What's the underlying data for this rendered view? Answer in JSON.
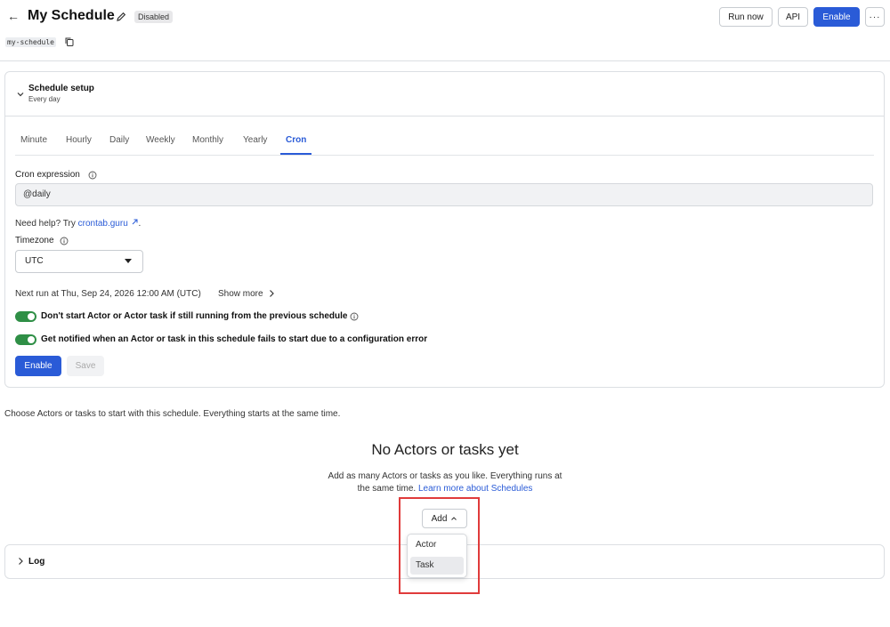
{
  "header": {
    "title": "My Schedule",
    "status": "Disabled",
    "slug": "my-schedule",
    "buttons": {
      "run_now": "Run now",
      "api": "API",
      "enable": "Enable",
      "more": "···"
    }
  },
  "setup": {
    "title": "Schedule setup",
    "subtitle": "Every day",
    "tabs": [
      "Minute",
      "Hourly",
      "Daily",
      "Weekly",
      "Monthly",
      "Yearly",
      "Cron"
    ],
    "active_tab": "Cron",
    "cron_label": "Cron expression",
    "cron_value": "@daily",
    "help_prefix": "Need help? Try ",
    "help_link": "crontab.guru",
    "help_suffix": ".",
    "timezone_label": "Timezone",
    "timezone_value": "UTC",
    "next_run": "Next run at Thu, Sep 24, 2026 12:00 AM (UTC)",
    "show_more": "Show more",
    "toggle1": "Don't start Actor or Actor task if still running from the previous schedule",
    "toggle2": "Get notified when an Actor or task in this schedule fails to start due to a configuration error",
    "enable_label": "Enable",
    "save_label": "Save"
  },
  "actors": {
    "choose_text": "Choose Actors or tasks to start with this schedule. Everything starts at the same time.",
    "empty_title": "No Actors or tasks yet",
    "empty_desc_1": "Add as many Actors or tasks as you like. Everything runs at",
    "empty_desc_2": "the same time. ",
    "empty_link": "Learn more about Schedules",
    "add_label": "Add",
    "menu": [
      "Actor",
      "Task"
    ]
  },
  "log": {
    "title": "Log"
  },
  "colors": {
    "accent": "#2a5bd7",
    "toggle_on": "#2f8f46",
    "highlight": "#e03b3b"
  }
}
